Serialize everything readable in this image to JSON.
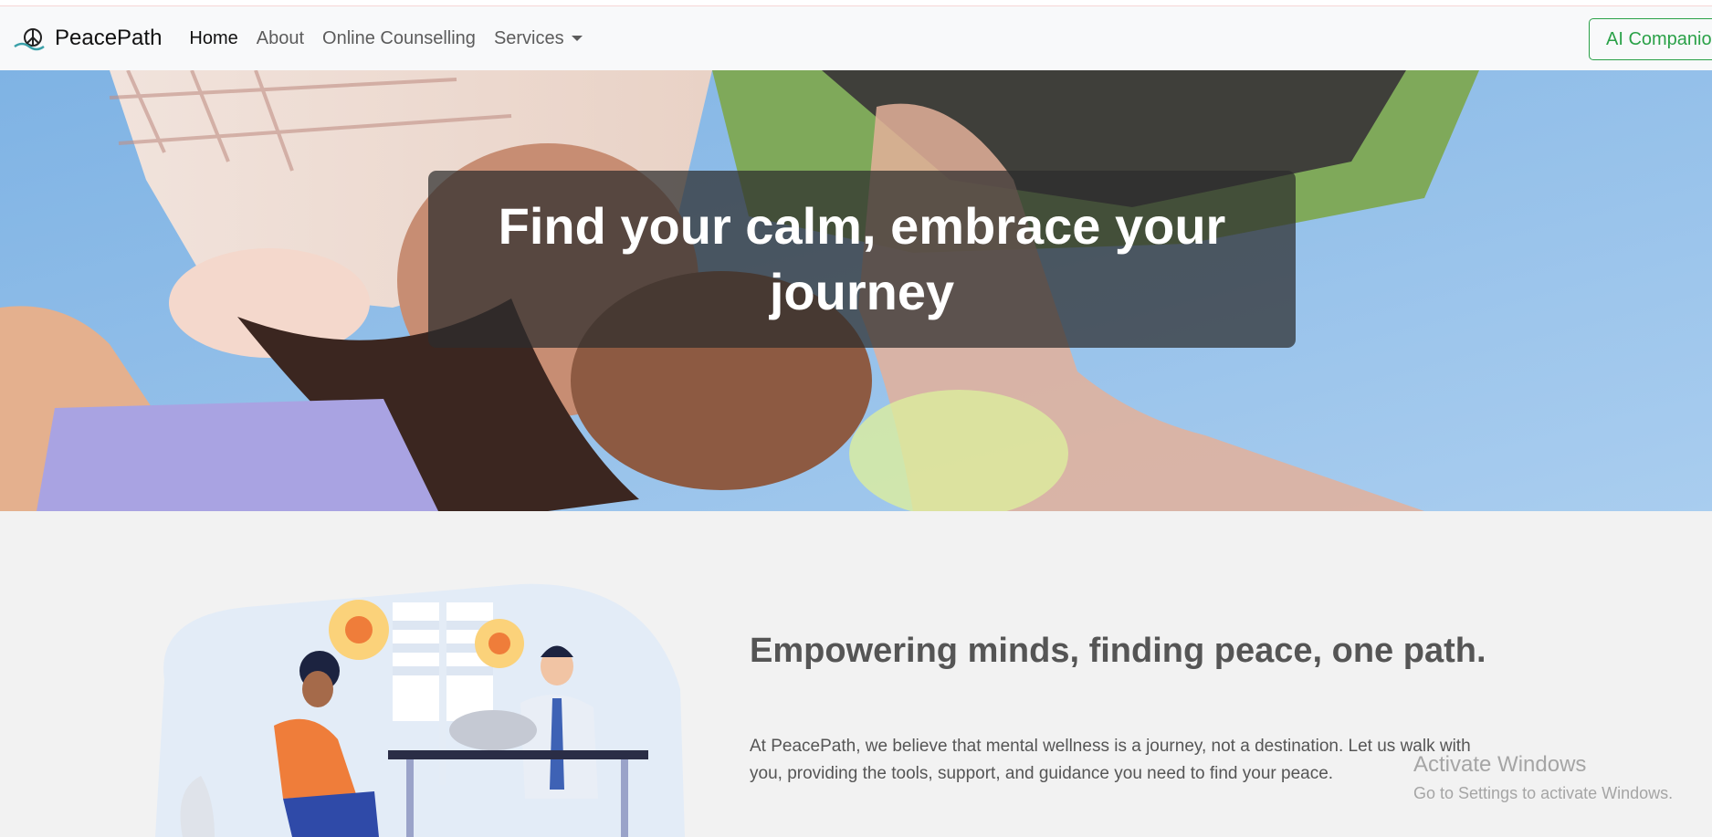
{
  "brand": {
    "name": "PeacePath",
    "logo_icon": "peace-sign-wave-icon"
  },
  "nav": {
    "items": [
      {
        "label": "Home",
        "active": true
      },
      {
        "label": "About"
      },
      {
        "label": "Online Counselling"
      },
      {
        "label": "Services",
        "dropdown": true
      }
    ],
    "cta_label": "AI Companion"
  },
  "hero": {
    "title": "Find your calm, embrace your journey"
  },
  "about": {
    "heading": "Empowering minds, finding peace, one path.",
    "text": "At PeacePath, we believe that mental wellness is a journey, not a destination. Let us walk with you, providing the tools, support, and guidance you need to find your peace."
  },
  "watermark": {
    "title": "Activate Windows",
    "subtitle": "Go to Settings to activate Windows."
  },
  "colors": {
    "accent_green": "#2aa148",
    "navbar_bg": "#f8f9fa",
    "body_bg": "#f2f2f2",
    "text_gray": "#555555"
  }
}
